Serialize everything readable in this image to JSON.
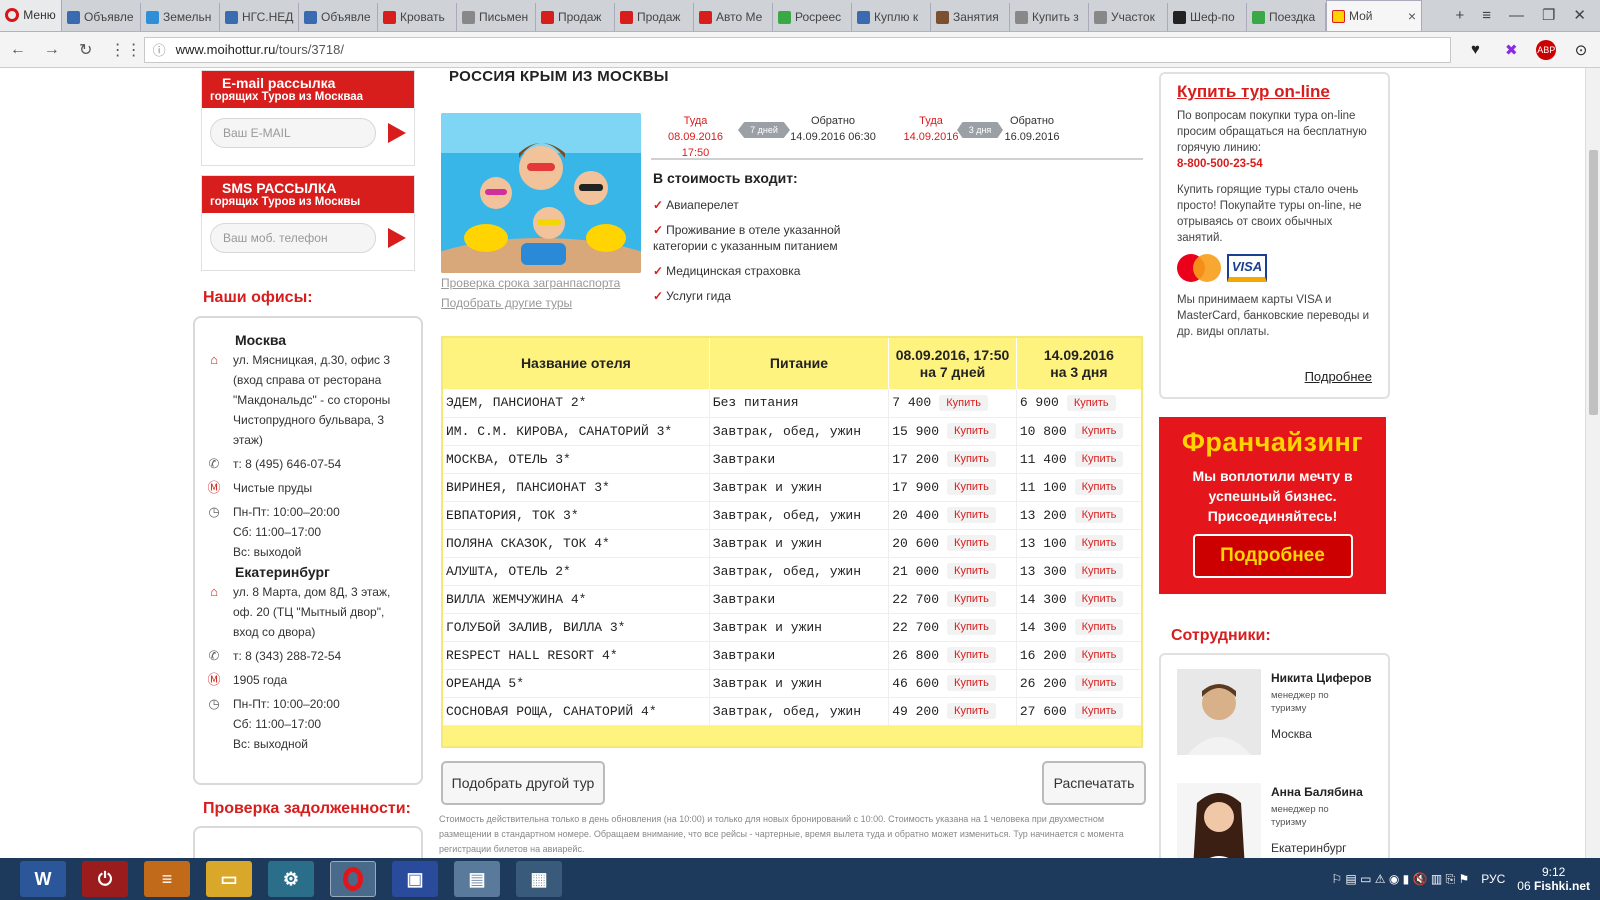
{
  "browser": {
    "menu_label": "Меню",
    "tabs": [
      {
        "label": "Объявле",
        "color": "#3a6ab0"
      },
      {
        "label": "Земельн",
        "color": "#2f8ed8"
      },
      {
        "label": "НГС.НЕД",
        "color": "#3a6ab0"
      },
      {
        "label": "Объявле",
        "color": "#3a6ab0"
      },
      {
        "label": "Кровать",
        "color": "#d81d1d"
      },
      {
        "label": "Письмен",
        "color": "#888888"
      },
      {
        "label": "Продаж",
        "color": "#d81d1d"
      },
      {
        "label": "Продаж",
        "color": "#d81d1d"
      },
      {
        "label": "Авто Ме",
        "color": "#d81d1d"
      },
      {
        "label": "Росреес",
        "color": "#39a845"
      },
      {
        "label": "Куплю к",
        "color": "#3a6ab0"
      },
      {
        "label": "Занятия",
        "color": "#7a5030"
      },
      {
        "label": "Купить з",
        "color": "#888888"
      },
      {
        "label": "Участок",
        "color": "#888888"
      },
      {
        "label": "Шеф-по",
        "color": "#222222"
      },
      {
        "label": "Поездка",
        "color": "#39a845"
      }
    ],
    "active_tab": "Мой",
    "url_domain": "www.moihottur.ru",
    "url_path": "/tours/3718/"
  },
  "left": {
    "email": {
      "title": "E-mail рассылка",
      "subtitle": "горящих Туров из Москваа",
      "placeholder": "Ваш E-MAIL"
    },
    "sms": {
      "title": "SMS РАССЫЛКА",
      "subtitle": "горящих Туров из Москвы",
      "placeholder": "Ваш моб. телефон"
    },
    "offices_title": "Наши офисы:",
    "moscow": {
      "city": "Москва",
      "address": "ул. Мясницкая, д.30, офис 3 (вход справа от ресторана \"Макдональдс\" - со стороны Чистопрудного бульвара, 3 этаж)",
      "phone": "т: 8 (495) 646-07-54",
      "metro": "Чистые пруды",
      "hours1": "Пн-Пт: 10:00–20:00",
      "hours2": "Сб: 11:00–17:00",
      "hours3": "Вс: выходой"
    },
    "ekb": {
      "city": "Екатеринбург",
      "address": "ул. 8 Марта, дом 8Д, 3 этаж, оф. 20 (ТЦ \"Мытный двор\", вход со двора)",
      "phone": "т: 8 (343) 288-72-54",
      "metro": "1905 года",
      "hours1": "Пн-Пт: 10:00–20:00",
      "hours2": "Сб: 11:00–17:00",
      "hours3": "Вс: выходной"
    },
    "debt_title": "Проверка задолженности:"
  },
  "tour": {
    "title": "РОССИЯ КРЫМ ИЗ МОСКВЫ",
    "link_passport": "Проверка срока загранпаспорта",
    "link_other": "Подобрать другие туры",
    "trip1": {
      "there": "Туда",
      "there_date": "08.09.2016 17:50",
      "days": "7 дней",
      "back": "Обратно",
      "back_date": "14.09.2016 06:30"
    },
    "trip2": {
      "there": "Туда",
      "there_date": "14.09.2016",
      "days": "3 дня",
      "back": "Обратно",
      "back_date": "16.09.2016"
    },
    "included_title": "В стоимость входит:",
    "included": [
      "Авиаперелет",
      "Проживание в отеле указанной категории с указанным питанием",
      "Медицинская страховка",
      "Услуги гида"
    ],
    "table": {
      "headers": [
        "Название отеля",
        "Питание",
        "08.09.2016, 17:50 на 7 дней",
        "14.09.2016 на 3 дня"
      ],
      "buy_label": "Купить",
      "rows": [
        {
          "hotel": "ЭДЕМ, ПАНСИОНАТ 2*",
          "meal": "Без питания",
          "p1": "7 400",
          "p2": "6 900"
        },
        {
          "hotel": "ИМ. С.М. КИРОВА, САНАТОРИЙ 3*",
          "meal": "Завтрак, обед, ужин",
          "p1": "15 900",
          "p2": "10 800"
        },
        {
          "hotel": "МОСКВА, ОТЕЛЬ 3*",
          "meal": "Завтраки",
          "p1": "17 200",
          "p2": "11 400"
        },
        {
          "hotel": "ВИРИНЕЯ, ПАНСИОНАТ 3*",
          "meal": "Завтрак и ужин",
          "p1": "17 900",
          "p2": "11 100"
        },
        {
          "hotel": "ЕВПАТОРИЯ, ТОК 3*",
          "meal": "Завтрак, обед, ужин",
          "p1": "20 400",
          "p2": "13 200"
        },
        {
          "hotel": "ПОЛЯНА СКАЗОК, ТОК 4*",
          "meal": "Завтрак и ужин",
          "p1": "20 600",
          "p2": "13 100"
        },
        {
          "hotel": "АЛУШТА, ОТЕЛЬ 2*",
          "meal": "Завтрак, обед, ужин",
          "p1": "21 000",
          "p2": "13 300"
        },
        {
          "hotel": "ВИЛЛА ЖЕМЧУЖИНА 4*",
          "meal": "Завтраки",
          "p1": "22 700",
          "p2": "14 300"
        },
        {
          "hotel": "ГОЛУБОЙ ЗАЛИВ, ВИЛЛА 3*",
          "meal": "Завтрак и ужин",
          "p1": "22 700",
          "p2": "14 300"
        },
        {
          "hotel": "RESPECT HALL RESORT 4*",
          "meal": "Завтраки",
          "p1": "26 800",
          "p2": "16 200"
        },
        {
          "hotel": "ОРЕАНДА 5*",
          "meal": "Завтрак и ужин",
          "p1": "46 600",
          "p2": "26 200"
        },
        {
          "hotel": "СОСНОВАЯ РОЩА, САНАТОРИЙ 4*",
          "meal": "Завтрак, обед, ужин",
          "p1": "49 200",
          "p2": "27 600"
        }
      ]
    },
    "btn_other_tour": "Подобрать другой тур",
    "btn_print": "Распечатать",
    "footnote": "Стоимость действительна только в день обновления (на 10:00) и только для новых бронирований с 10:00. Стоимость указана на 1 человека при двухместном размещении в стандартном номере. Обращаем внимание, что все рейсы - чартерные, время вылета туда и обратно может измениться. Тур начинается с момента регистрации билетов на авиарейс."
  },
  "right": {
    "buy_title": "Купить тур on-line",
    "buy_text1": "По вопросам покупки тура on-line просим обращаться на бесплатную горячую линию:",
    "buy_phone": "8-800-500-23-54",
    "buy_text2": "Купить горящие туры стало очень просто! Покупайте туры on-line, не отрываясь от своих обычных занятий.",
    "visa_label": "VISA",
    "buy_text3": "Мы принимаем карты VISA и MasterCard, банковские переводы и др. виды оплаты.",
    "more_label": "Подробнее",
    "franchise_title": "Франчайзинг",
    "franchise_text": "Мы воплотили мечту в успешный бизнес. Присоединяйтесь!",
    "franchise_btn": "Подробнее",
    "staff_title": "Сотрудники:",
    "staff": [
      {
        "name": "Никита Циферов",
        "role": "менеджер по туризму",
        "city": "Москва"
      },
      {
        "name": "Анна Балябина",
        "role": "менеджер по туризму",
        "city": "Екатеринбург"
      }
    ]
  },
  "taskbar": {
    "lang": "РУС",
    "time": "9:12",
    "date": "06",
    "watermark": "Fishki.net"
  }
}
